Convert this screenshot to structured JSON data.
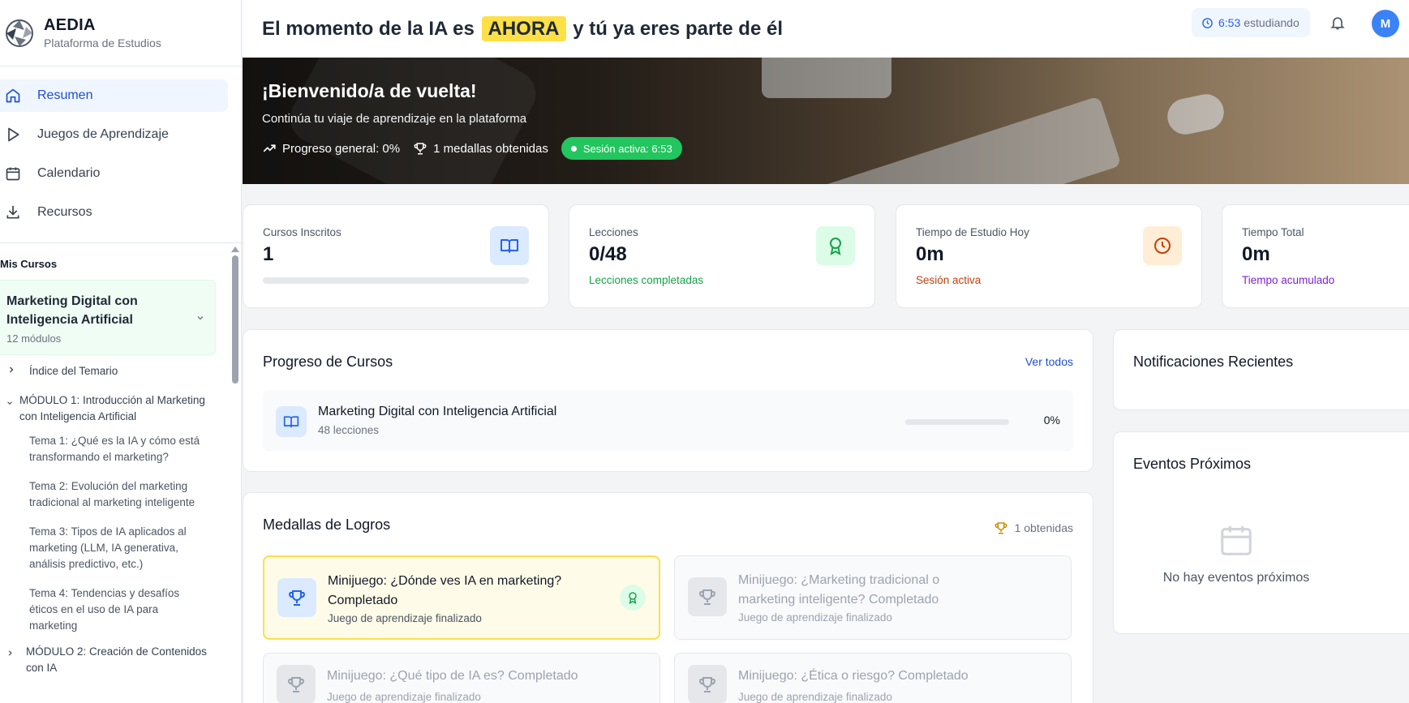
{
  "brand": {
    "name": "AEDIA",
    "subtitle": "Plataforma de Estudios"
  },
  "nav": [
    {
      "label": "Resumen",
      "icon": "home-icon",
      "active": true
    },
    {
      "label": "Juegos de Aprendizaje",
      "icon": "play-icon"
    },
    {
      "label": "Calendario",
      "icon": "calendar-icon"
    },
    {
      "label": "Recursos",
      "icon": "download-icon"
    }
  ],
  "courses": {
    "title": "Mis Cursos",
    "course": {
      "name": "Marketing Digital con Inteligencia Artificial",
      "modules": "12 módulos"
    },
    "tree": [
      {
        "label": "Índice del Temario"
      },
      {
        "label": "MÓDULO 1: Introducción al Marketing con Inteligencia Artificial"
      },
      {
        "label": "Tema 1: ¿Qué es la IA y cómo está transformando el marketing?"
      },
      {
        "label": "Tema 2: Evolución del marketing tradicional al marketing inteligente"
      },
      {
        "label": "Tema 3: Tipos de IA aplicados al marketing (LLM, IA generativa, análisis predictivo, etc.)"
      },
      {
        "label": "Tema 4: Tendencias y desafíos éticos en el uso de IA para marketing"
      },
      {
        "label": "MÓDULO 2: Creación de Contenidos con IA"
      }
    ]
  },
  "header": {
    "headline_pre": "El momento de la IA es",
    "headline_highlight": "AHORA",
    "headline_post": "y tú ya eres parte de él",
    "study_time": "6:53",
    "study_label": "estudiando",
    "avatar_initial": "M"
  },
  "hero": {
    "title": "¡Bienvenido/a de vuelta!",
    "subtitle": "Continúa tu viaje de aprendizaje en la plataforma",
    "progress": "Progreso general: 0%",
    "medals": "1 medallas obtenidas",
    "session": "Sesión activa: 6:53"
  },
  "stats": [
    {
      "label": "Cursos Inscritos",
      "value": "1",
      "progress": 0,
      "color": "#2563eb",
      "bg": "#dbeafe"
    },
    {
      "label": "Lecciones",
      "value": "0/48",
      "note": "Lecciones completadas",
      "color": "#16a34a",
      "bg": "#dcfce7"
    },
    {
      "label": "Tiempo de Estudio Hoy",
      "value": "0m",
      "note": "Sesión activa",
      "color": "#c2410c",
      "bg": "#ffedd5"
    },
    {
      "label": "Tiempo Total",
      "value": "0m",
      "note": "Tiempo acumulado",
      "color": "#7e22ce"
    }
  ],
  "progress_panel": {
    "title": "Progreso de Cursos",
    "link": "Ver todos",
    "course": {
      "name": "Marketing Digital con Inteligencia Artificial",
      "lessons": "48 lecciones",
      "percent": "0%",
      "progress": 0
    }
  },
  "medals_panel": {
    "title": "Medallas de Logros",
    "earned": "1 obtenidas",
    "medals": [
      {
        "title": "Minijuego: ¿Dónde ves IA en marketing? Completado",
        "subtitle": "Juego de aprendizaje finalizado",
        "earned": true
      },
      {
        "title": "Minijuego: ¿Marketing tradicional o marketing inteligente? Completado",
        "subtitle": "Juego de aprendizaje finalizado",
        "earned": false
      },
      {
        "title": "Minijuego: ¿Qué tipo de IA es? Completado",
        "subtitle": "Juego de aprendizaje finalizado",
        "earned": false
      },
      {
        "title": "Minijuego: ¿Ética o riesgo? Completado",
        "subtitle": "Juego de aprendizaje finalizado",
        "earned": false
      }
    ]
  },
  "notifications": {
    "title": "Notificaciones Recientes"
  },
  "events": {
    "title": "Eventos Próximos",
    "empty": "No hay eventos próximos"
  }
}
